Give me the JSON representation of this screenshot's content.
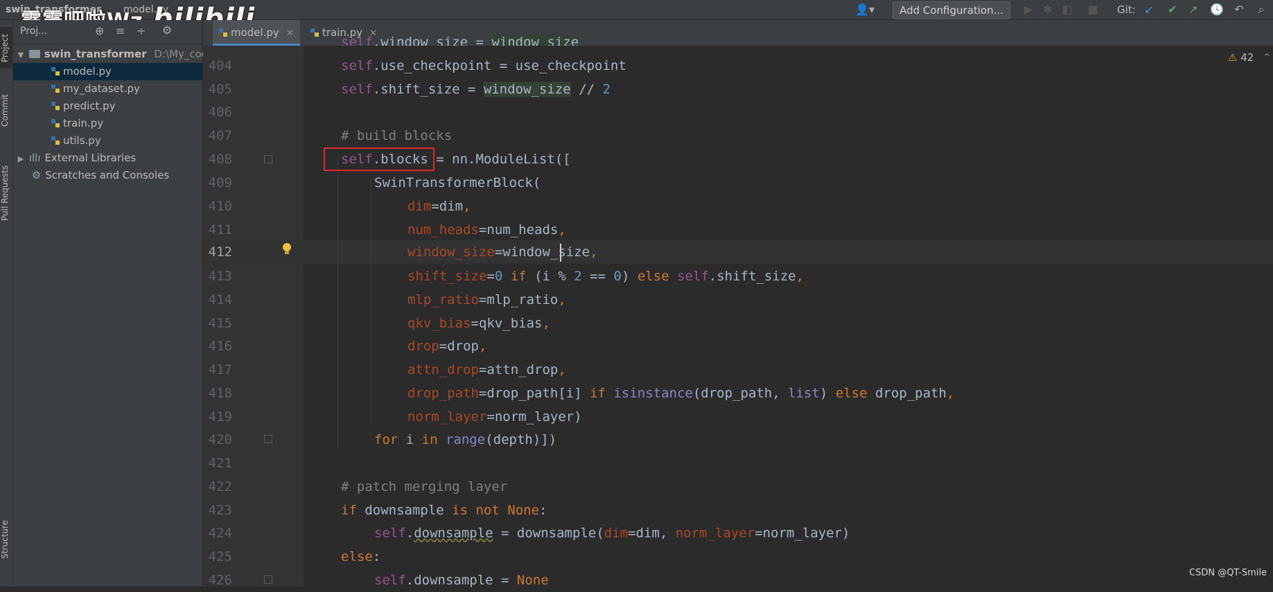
{
  "navbar": {
    "project_crumb": "swin_transformer",
    "file_crumb": "model.py",
    "watermark": "霹雳吧啦Wz",
    "watermark_logo": "bilibili",
    "add_configuration": "Add Configuration...",
    "git_label": "Git:"
  },
  "left_strip": {
    "project": "Project",
    "commit": "Commit",
    "pull_requests": "Pull Requests",
    "structure": "Structure"
  },
  "project_panel": {
    "header_label": "Proj...",
    "root": {
      "name": "swin_transformer",
      "path": "D:\\My_code"
    },
    "files": [
      "model.py",
      "my_dataset.py",
      "predict.py",
      "train.py",
      "utils.py"
    ],
    "selected_file": "model.py",
    "external_libraries": "External Libraries",
    "scratches": "Scratches and Consoles"
  },
  "tabs": [
    {
      "label": "model.py",
      "active": true
    },
    {
      "label": "train.py",
      "active": false
    }
  ],
  "editor": {
    "warning_count": "42",
    "current_line": "412",
    "line_numbers": [
      "404",
      "405",
      "406",
      "407",
      "408",
      "409",
      "410",
      "411",
      "412",
      "413",
      "414",
      "415",
      "416",
      "417",
      "418",
      "419",
      "420",
      "421",
      "422",
      "423",
      "424",
      "425",
      "426"
    ]
  },
  "code": {
    "l403": {
      "self": "self",
      "rest": ".window_size = ",
      "val": "window_size"
    },
    "l404": {
      "self": "self",
      "rest": ".use_checkpoint = use_checkpoint"
    },
    "l405": {
      "self": "self",
      "a": ".shift_size = ",
      "hl": "window_size",
      "b": " // ",
      "num": "2"
    },
    "l407": {
      "comment": "# build blocks"
    },
    "l408": {
      "self": "self",
      "a": ".blocks",
      "b": " = nn.ModuleList(["
    },
    "l409": {
      "text": "SwinTransformerBlock("
    },
    "l410": {
      "p": "dim",
      "v": "=dim",
      "c": ","
    },
    "l411": {
      "p": "num_heads",
      "v": "=num_heads",
      "c": ","
    },
    "l412": {
      "p": "window_size",
      "v": "=window_size",
      "c": ","
    },
    "l413": {
      "p": "shift_size",
      "eq": "=",
      "n0": "0",
      "if": " if ",
      "a": "(i % ",
      "n2": "2",
      "b": " == ",
      "n3": "0",
      "c": ") ",
      "else": "else ",
      "self": "self",
      "d": ".shift_size",
      "comma": ","
    },
    "l414": {
      "p": "mlp_ratio",
      "v": "=mlp_ratio",
      "c": ","
    },
    "l415": {
      "p": "qkv_bias",
      "v": "=qkv_bias",
      "c": ","
    },
    "l416": {
      "p": "drop",
      "v": "=drop",
      "c": ","
    },
    "l417": {
      "p": "attn_drop",
      "v": "=attn_drop",
      "c": ","
    },
    "l418": {
      "p": "drop_path",
      "v": "=drop_path[i] ",
      "if": "if ",
      "bi": "isinstance",
      "a": "(drop_path, ",
      "list": "list",
      "b": ") ",
      "else": "else ",
      "c": "drop_path",
      "comma": ","
    },
    "l419": {
      "p": "norm_layer",
      "v": "=norm_layer)"
    },
    "l420": {
      "for": "for ",
      "a": "i ",
      "in": "in ",
      "range": "range",
      "b": "(depth)])"
    },
    "l422": {
      "comment": "# patch merging layer"
    },
    "l423": {
      "if": "if ",
      "a": "downsample ",
      "is": "is not ",
      "none": "None",
      "b": ":"
    },
    "l424": {
      "self": "self",
      "a": ".",
      "ds": "downsample",
      "b": " = downsample(",
      "p1": "dim",
      "c": "=dim, ",
      "p2": "norm_layer",
      "d": "=norm_layer)"
    },
    "l425": {
      "else": "else",
      "a": ":"
    },
    "l426": {
      "self": "self",
      "a": ".downsample = ",
      "none": "None"
    }
  },
  "watermark_br": "CSDN @QT-Smile",
  "colors": {
    "keyword": "#cc7832",
    "self": "#94558d",
    "param": "#aa4926",
    "number": "#6897bb",
    "comment": "#808080",
    "builtin": "#8888c6",
    "text": "#a9b7c6"
  }
}
